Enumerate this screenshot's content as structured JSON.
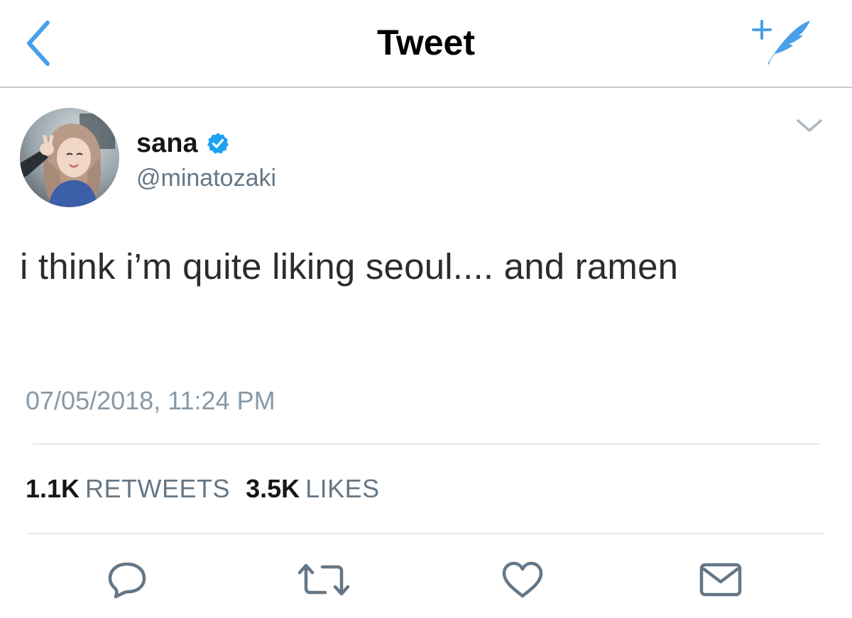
{
  "header": {
    "title": "Tweet",
    "back_icon": "chevron-left-icon",
    "compose_icon": "compose-tweet-icon",
    "accent_color": "#4a9fe9"
  },
  "author": {
    "display_name": "sana",
    "handle": "@minatozaki",
    "verified": true,
    "verified_color": "#1da1f2"
  },
  "tweet": {
    "text": "i think i’m quite liking seoul.... and ramen",
    "timestamp": "07/05/2018, 11:24 PM"
  },
  "stats": {
    "retweets_count": "1.1K",
    "retweets_label": "RETWEETS",
    "likes_count": "3.5K",
    "likes_label": "LIKES"
  },
  "actions": [
    "reply-icon",
    "retweet-icon",
    "like-icon",
    "direct-message-icon"
  ]
}
